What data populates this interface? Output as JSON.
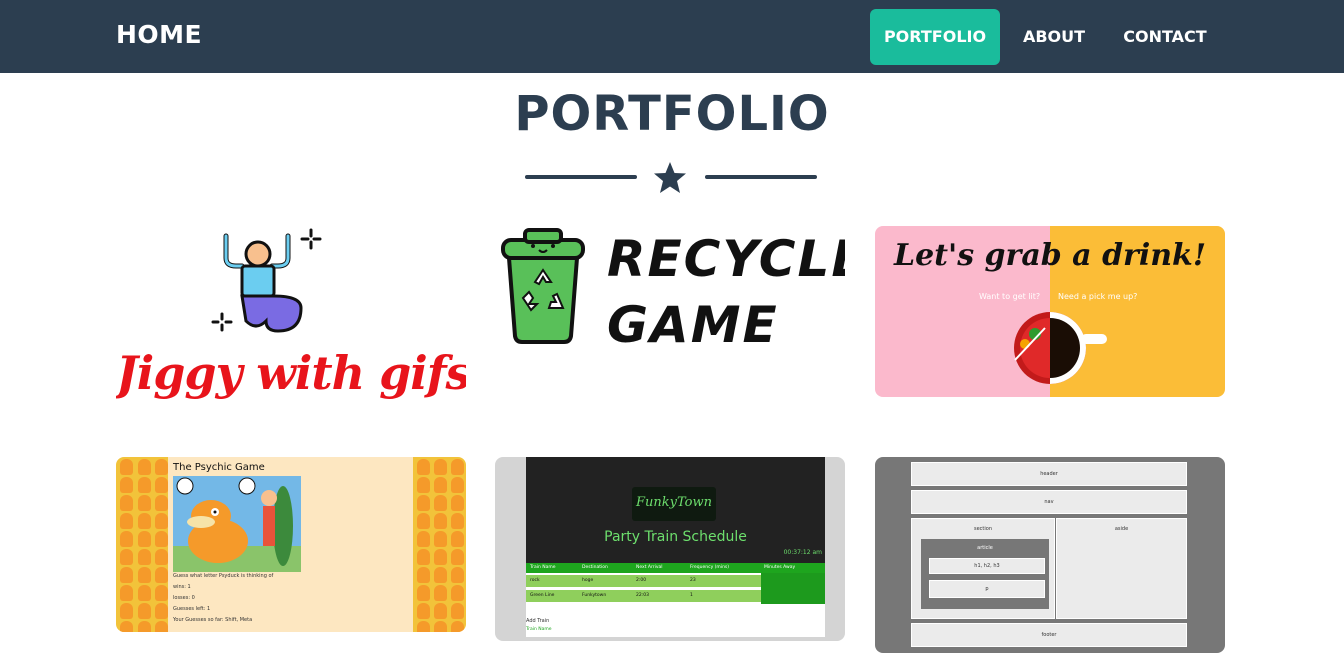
{
  "nav": {
    "brand": "HOME",
    "items": [
      {
        "label": "PORTFOLIO",
        "active": true
      },
      {
        "label": "ABOUT",
        "active": false
      },
      {
        "label": "CONTACT",
        "active": false
      }
    ]
  },
  "colors": {
    "navbar": "#2c3e50",
    "accent": "#1abc9c",
    "text": "#2c3e50"
  },
  "heading": {
    "title": "PORTFOLIO",
    "divider_icon": "star-icon"
  },
  "portfolio": {
    "jiggy": {
      "title": "Jiggy with gifs",
      "icon": "dancing-person-icon"
    },
    "recycle": {
      "title_line1": "RECYCLE",
      "title_line2": "GAME",
      "icon": "recycle-bin-icon"
    },
    "drink": {
      "title": "Let's grab a drink!",
      "left_caption": "Want to get lit?",
      "right_caption": "Need a pick me up?"
    },
    "psychic": {
      "title": "The Psychic Game",
      "prompt": "Guess what letter Psyduck is thinking of",
      "wins": "wins: 1",
      "losses": "losses: 0",
      "guesses_left": "Guesses left: 1",
      "guesses_so_far": "Your Guesses so far: Shift, Meta"
    },
    "train": {
      "logo": "FunkyTown",
      "heading": "Party Train Schedule",
      "clock": "00:37:12 am",
      "columns": [
        "Train Name",
        "Destination",
        "Next Arrival",
        "Frequency (mins)",
        "Minutes Away"
      ],
      "rows": [
        [
          "rock",
          "hoge",
          "2:00",
          "23",
          ""
        ],
        [
          "Green Line",
          "Funkytown",
          "22:03",
          "1",
          ""
        ]
      ],
      "add_label": "Add Train",
      "name_label": "Train Name"
    },
    "wireframe": {
      "header": "header",
      "nav": "nav",
      "section": "section",
      "aside": "aside",
      "article": "article",
      "headings": "h1, h2, h3",
      "paragraph": "p",
      "footer": "footer"
    }
  }
}
